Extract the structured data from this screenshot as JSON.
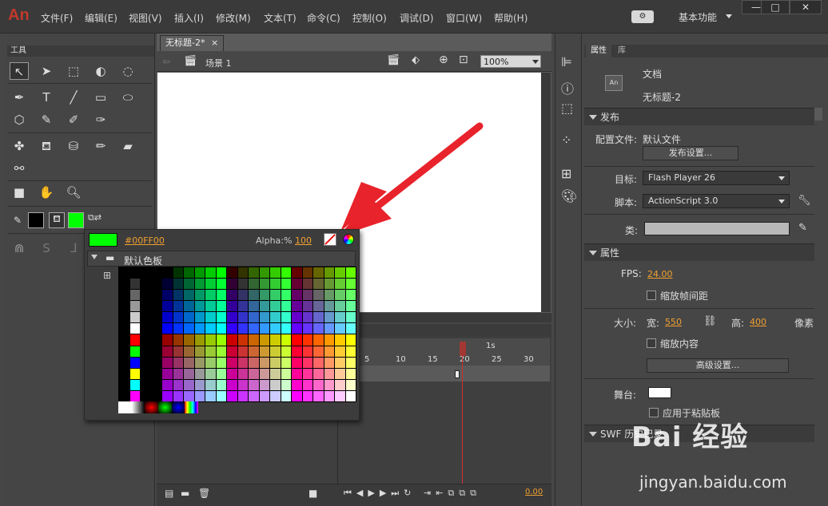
{
  "app": {
    "logo": "An"
  },
  "menu": [
    "文件(F)",
    "编辑(E)",
    "视图(V)",
    "插入(I)",
    "修改(M)",
    "文本(T)",
    "命令(C)",
    "控制(O)",
    "调试(D)",
    "窗口(W)",
    "帮助(H)"
  ],
  "workspace": "基本功能",
  "window_buttons": [
    "—",
    "□",
    "✕"
  ],
  "tools_panel": {
    "title": "工具"
  },
  "document": {
    "tab": "无标题-2*",
    "tab_close": "×",
    "scene": "场景 1",
    "zoom": "100%"
  },
  "timeline": {
    "marker": "1s",
    "frames": [
      "5",
      "10",
      "15",
      "20",
      "25",
      "30"
    ],
    "fps_display": "0.00"
  },
  "color_popup": {
    "hex": "#00FF00",
    "alpha_label": "Alpha:%",
    "alpha_value": "100",
    "palette_name": "默认色板",
    "selected_color": "#00ff00"
  },
  "properties": {
    "tabs": [
      "属性",
      "库"
    ],
    "doc_icon": "An",
    "doc_type": "文档",
    "doc_name": "无标题-2",
    "publish_section": "发布",
    "profile_label": "配置文件:",
    "profile_value": "默认文件",
    "publish_settings": "发布设置...",
    "target_label": "目标:",
    "target_value": "Flash Player 26",
    "script_label": "脚本:",
    "script_value": "ActionScript 3.0",
    "class_label": "类:",
    "attributes_section": "属性",
    "fps_label": "FPS:",
    "fps_value": "24.00",
    "scale_spans": "缩放帧间距",
    "size_label": "大小:",
    "width_label": "宽:",
    "width_value": "550",
    "height_label": "高:",
    "height_value": "400",
    "unit": "像素",
    "scale_content": "缩放内容",
    "advanced": "高级设置...",
    "stage_label": "舞台:",
    "apply_clipboard": "应用于粘贴板",
    "swf_history": "SWF 历史记录"
  },
  "watermark": {
    "line1": "Bai 经验",
    "line2": "jingyan.baidu.com"
  },
  "colors": {
    "accent_value": "#f0a030",
    "arrow": "#e8232b",
    "stroke": "#000000",
    "fill": "#00ff00"
  }
}
